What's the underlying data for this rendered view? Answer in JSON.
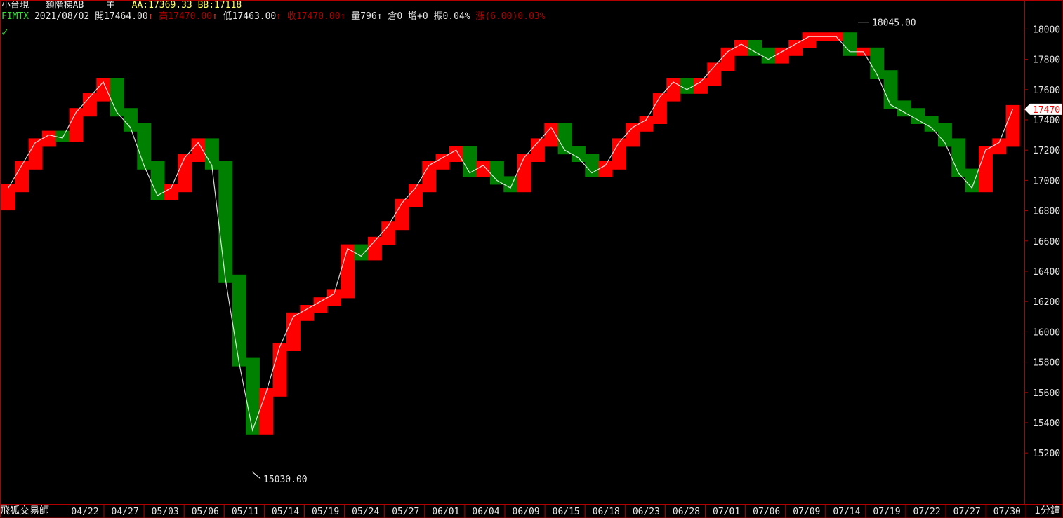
{
  "header": {
    "symbol": "小台現",
    "indicator": "類階梯AB",
    "main": "主",
    "aa": "AA:17369.33",
    "bb": "BB:17118",
    "code": "FIMTX",
    "date": "2021/08/02",
    "open": "開17464.00",
    "high": "高17470.00",
    "low": "低17463.00",
    "close": "收17470.00",
    "volume": "量796",
    "oi": "倉0",
    "oi_change": "增+0",
    "amplitude": "振0.04%",
    "change": "漲(6.00)0.03%",
    "arrow": "↑"
  },
  "footer": {
    "brand": "飛狐交易師",
    "timeframe": "1分鐘"
  },
  "colors": {
    "up": "#ff0000",
    "down": "#008000",
    "axis": "#b00000",
    "text": "#e8e8e8",
    "price_tag_bg": "#ffffff",
    "price_tag_text": "#ff0000"
  },
  "chart_data": {
    "type": "line",
    "title": "",
    "ylim": [
      15030,
      18045
    ],
    "y_ticks": [
      15200,
      15400,
      15600,
      15800,
      16000,
      16200,
      16400,
      16600,
      16800,
      17000,
      17200,
      17400,
      17600,
      17800,
      18000
    ],
    "x_ticks": [
      "04/22",
      "04/27",
      "05/03",
      "05/06",
      "05/11",
      "05/14",
      "05/19",
      "05/24",
      "05/27",
      "06/01",
      "06/04",
      "06/09",
      "06/15",
      "06/18",
      "06/23",
      "06/28",
      "07/01",
      "07/06",
      "07/09",
      "07/14",
      "07/19",
      "07/22",
      "07/27",
      "07/30"
    ],
    "annotations": {
      "high_label": "18045.00",
      "low_label": "15030.00",
      "last_price": "17470"
    },
    "series": [
      {
        "x": [
          "04/19",
          "04/20",
          "04/21",
          "04/22",
          "04/23",
          "04/26",
          "04/27",
          "04/28",
          "04/29",
          "04/30",
          "05/03",
          "05/04",
          "05/05",
          "05/06",
          "05/07",
          "05/10",
          "05/11",
          "05/12",
          "05/13",
          "05/14",
          "05/17",
          "05/18",
          "05/19",
          "05/20",
          "05/21",
          "05/24",
          "05/25",
          "05/26",
          "05/27",
          "05/28",
          "05/31",
          "06/01",
          "06/02",
          "06/03",
          "06/04",
          "06/07",
          "06/08",
          "06/09",
          "06/10",
          "06/11",
          "06/15",
          "06/16",
          "06/17",
          "06/18",
          "06/21",
          "06/22",
          "06/23",
          "06/24",
          "06/25",
          "06/28",
          "06/29",
          "06/30",
          "07/01",
          "07/02",
          "07/05",
          "07/06",
          "07/07",
          "07/08",
          "07/09",
          "07/12",
          "07/13",
          "07/14",
          "07/15",
          "07/16",
          "07/19",
          "07/20",
          "07/21",
          "07/22",
          "07/23",
          "07/26",
          "07/27",
          "07/28",
          "07/29",
          "07/30",
          "08/02"
        ],
        "values": [
          16950,
          17100,
          17250,
          17300,
          17280,
          17450,
          17550,
          17650,
          17450,
          17350,
          17100,
          16900,
          16950,
          17150,
          17250,
          17100,
          16350,
          15800,
          15350,
          15600,
          15900,
          16100,
          16150,
          16200,
          16250,
          16550,
          16500,
          16600,
          16700,
          16850,
          16950,
          17100,
          17150,
          17200,
          17050,
          17100,
          17000,
          16950,
          17150,
          17250,
          17350,
          17200,
          17150,
          17050,
          17100,
          17250,
          17350,
          17400,
          17550,
          17650,
          17600,
          17650,
          17750,
          17850,
          17900,
          17850,
          17800,
          17850,
          17900,
          17950,
          17950,
          17950,
          17850,
          17850,
          17700,
          17500,
          17450,
          17400,
          17350,
          17250,
          17050,
          16950,
          17200,
          17250,
          17470
        ]
      }
    ]
  }
}
